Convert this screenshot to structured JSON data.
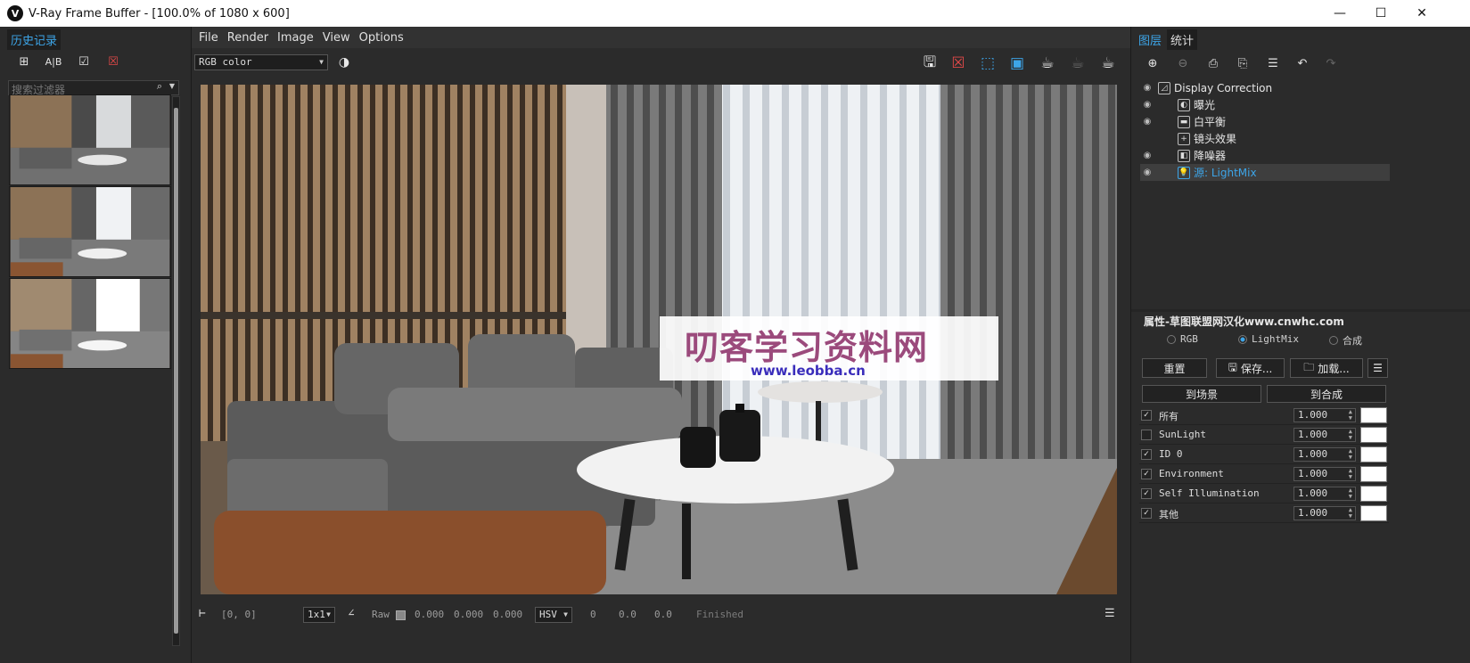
{
  "window": {
    "title": "V-Ray Frame Buffer - [100.0% of 1080 x 600]",
    "logo": "V",
    "controls": [
      "—",
      "☐",
      "✕"
    ]
  },
  "history": {
    "tab_label": "历史记录",
    "search_placeholder": "搜索过滤器",
    "thumb_count": 3
  },
  "menu": [
    "File",
    "Render",
    "Image",
    "View",
    "Options"
  ],
  "toolbar": {
    "channel": "RGB color",
    "icons": [
      "save-image-icon",
      "clear-image-icon",
      "region-render-icon",
      "track-mouse-icon",
      "render-interactive-icon",
      "render-last-icon",
      "render-icon"
    ]
  },
  "status": {
    "coords": "[0, 0]",
    "zoom": "1x1",
    "raw_label": "Raw",
    "raw_vals": [
      "0.000",
      "0.000",
      "0.000"
    ],
    "color_mode": "HSV",
    "hsv_vals": [
      "0",
      "0.0",
      "0.0"
    ],
    "state": "Finished"
  },
  "layers": {
    "tabs": [
      "图层",
      "统计"
    ],
    "rows": [
      {
        "label": "Display Correction",
        "eye": true,
        "icon": "display-correction-icon",
        "indent": 0
      },
      {
        "label": "曝光",
        "eye": true,
        "icon": "exposure-icon",
        "indent": 1
      },
      {
        "label": "白平衡",
        "eye": true,
        "icon": "white-balance-icon",
        "indent": 1
      },
      {
        "label": "镜头效果",
        "eye": false,
        "icon": "lens-effects-icon",
        "indent": 1
      },
      {
        "label": "降噪器",
        "eye": true,
        "icon": "denoiser-icon",
        "indent": 1
      },
      {
        "label": "源: LightMix",
        "eye": true,
        "icon": "lightmix-icon",
        "indent": 1,
        "selected": true
      }
    ]
  },
  "properties": {
    "header": "属性-草图联盟网汉化www.cnwhc.com",
    "radios": [
      "RGB",
      "LightMix",
      "合成"
    ],
    "selected_radio": "LightMix",
    "buttons": {
      "reset": "重置",
      "save": "保存...",
      "load": "加载...",
      "to_scene": "到场景",
      "to_composite": "到合成"
    },
    "lights": [
      {
        "name": "所有",
        "checked": true,
        "value": "1.000"
      },
      {
        "name": "SunLight",
        "checked": false,
        "value": "1.000"
      },
      {
        "name": "ID 0",
        "checked": true,
        "value": "1.000"
      },
      {
        "name": "Environment",
        "checked": true,
        "value": "1.000"
      },
      {
        "name": "Self Illumination",
        "checked": true,
        "value": "1.000"
      },
      {
        "name": "其他",
        "checked": true,
        "value": "1.000"
      }
    ]
  },
  "watermark": {
    "title": "叨客学习资料网",
    "url": "www.leobba.cn"
  },
  "colors": {
    "accent": "#3da5e8",
    "panel": "#2b2b2b",
    "watermark_text": "#9b4a7c"
  }
}
